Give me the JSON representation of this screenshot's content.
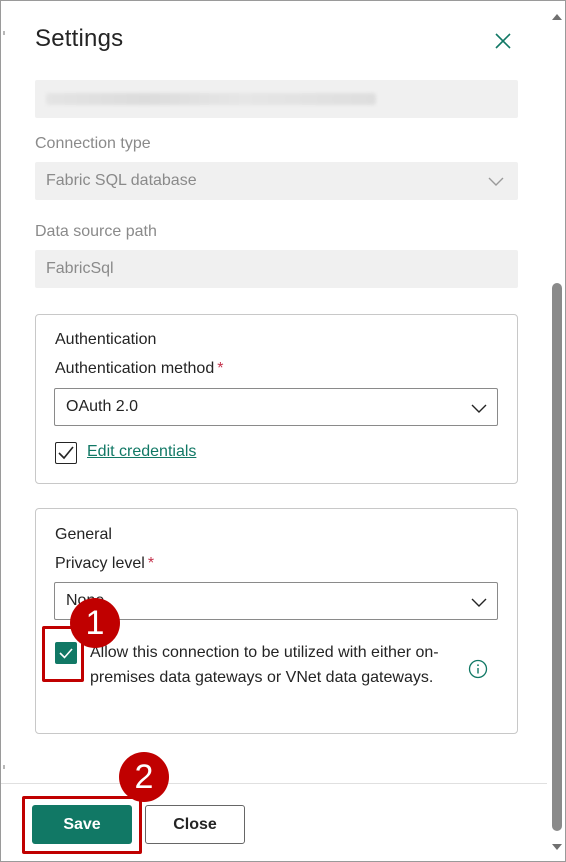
{
  "panel": {
    "title": "Settings"
  },
  "connection_type": {
    "label": "Connection type",
    "value": "Fabric SQL database"
  },
  "data_source_path": {
    "label": "Data source path",
    "value": "FabricSql"
  },
  "authentication": {
    "section_title": "Authentication",
    "method_label": "Authentication method",
    "required_mark": "*",
    "method_value": "OAuth 2.0",
    "edit_credentials_label": "Edit credentials",
    "edit_credentials_checked": true
  },
  "general": {
    "section_title": "General",
    "privacy_label": "Privacy level",
    "required_mark": "*",
    "privacy_value": "None",
    "gateway_checkbox_label": "Allow this connection to be utilized with either on-premises data gateways or VNet data gateways.",
    "gateway_checked": true
  },
  "footer": {
    "save_label": "Save",
    "close_label": "Close"
  },
  "callouts": {
    "step1": "1",
    "step2": "2"
  },
  "colors": {
    "accent": "#117865",
    "callout": "#c00000",
    "required": "#c4314b"
  }
}
